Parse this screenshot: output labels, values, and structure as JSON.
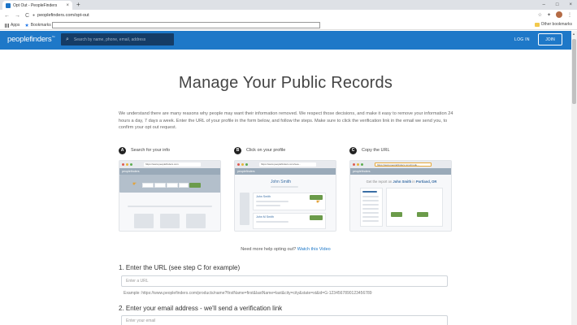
{
  "browser": {
    "tab_title": "Opt Out - PeopleFinders",
    "tab_close": "×",
    "new_tab": "+",
    "url": "peoplefinders.com/opt-out",
    "nav": {
      "back": "←",
      "forward": "→",
      "reload": "C"
    },
    "window_controls": {
      "minimize": "–",
      "maximize": "□",
      "close": "×"
    },
    "toolbar_icons": {
      "star": "☆",
      "extensions": "✦",
      "menu": "⋮"
    },
    "bookmarks": {
      "apps": "Apps",
      "bookmarks": "Bookmarks",
      "other": "Other bookmarks"
    }
  },
  "header": {
    "logo": "peoplefinders",
    "logo_mark": "™",
    "search_placeholder": "Search by name, phone, email, address",
    "login": "LOG IN",
    "join": "JOIN"
  },
  "page": {
    "title": "Manage Your Public Records",
    "intro": "We understand there are many reasons why people may want their information removed. We respect those decisions, and make it easy to remove your information 24 hours a day, 7 days a week. Enter the URL of your profile in the form below, and follow the steps. Make sure to click the verification link in the email we send you, to confirm your opt out request.",
    "steps": [
      {
        "letter": "A",
        "title": "Search for your info",
        "mini_url": "https://www.peoplefinders.com",
        "mini_brand": "peoplefinders"
      },
      {
        "letter": "B",
        "title": "Click on your profile",
        "mini_url": "https://www.peoplefinders.com/sea...",
        "mini_brand": "peoplefinders",
        "name": "John Smith",
        "name2": "John Smith",
        "name3": "John M Smith"
      },
      {
        "letter": "C",
        "title": "Copy the URL",
        "mini_url": "https://www.peoplefinders.com/produ...",
        "mini_brand": "peoplefinders",
        "report_prefix": "Get the report on ",
        "report_name": "John Smith",
        "report_mid": " in ",
        "report_place": "Portland, OR"
      }
    ],
    "help_text": "Need more help opting out?",
    "help_link": "Watch this Video",
    "section1_title": "1. Enter the URL (see step C for example)",
    "url_placeholder": "Enter a URL",
    "example": "Example: https://www.peoplefinders.com/products/name?firstName=first&lastName=last&city=city&state=st&id=G-1234567890123456789",
    "section2_title": "2. Enter your email address",
    "section2_sub": " - we'll send a verification link",
    "email_placeholder": "Enter your email"
  },
  "colors": {
    "brand": "#1e78c8",
    "search_bg": "#153c66",
    "button_green": "#6b9b4a"
  },
  "icons": [
    "search-icon",
    "lock-icon",
    "star-icon",
    "back-arrow-icon",
    "forward-arrow-icon",
    "reload-icon"
  ]
}
